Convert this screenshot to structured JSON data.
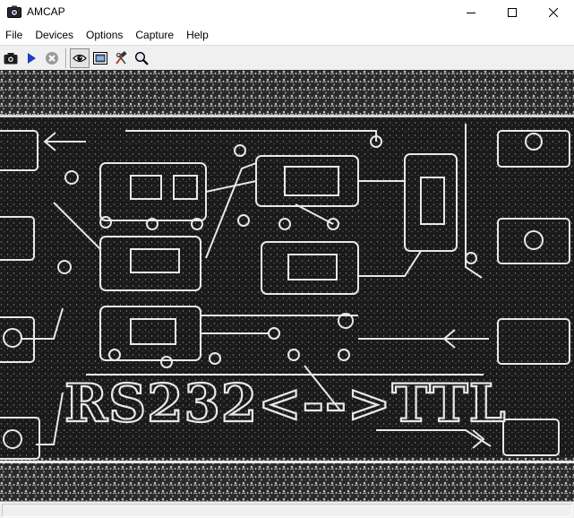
{
  "window": {
    "title": "AMCAP"
  },
  "menu": {
    "items": [
      "File",
      "Devices",
      "Options",
      "Capture",
      "Help"
    ]
  },
  "toolbar": {
    "buttons": [
      {
        "icon": "camera-icon",
        "active": false
      },
      {
        "icon": "play-icon",
        "active": false
      },
      {
        "icon": "stop-icon",
        "active": false
      },
      {
        "icon": "preview-eye-icon",
        "active": true
      },
      {
        "icon": "film-frame-icon",
        "active": false
      },
      {
        "icon": "tools-icon",
        "active": false
      },
      {
        "icon": "magnifier-icon",
        "active": false
      }
    ]
  },
  "preview": {
    "board_text": "RS232<-->TTL"
  },
  "status": {
    "text": ""
  },
  "colors": {
    "accent_play": "#1a3cc8",
    "preview_bg": "#1c1c1c",
    "trace": "#e8e8e8"
  }
}
